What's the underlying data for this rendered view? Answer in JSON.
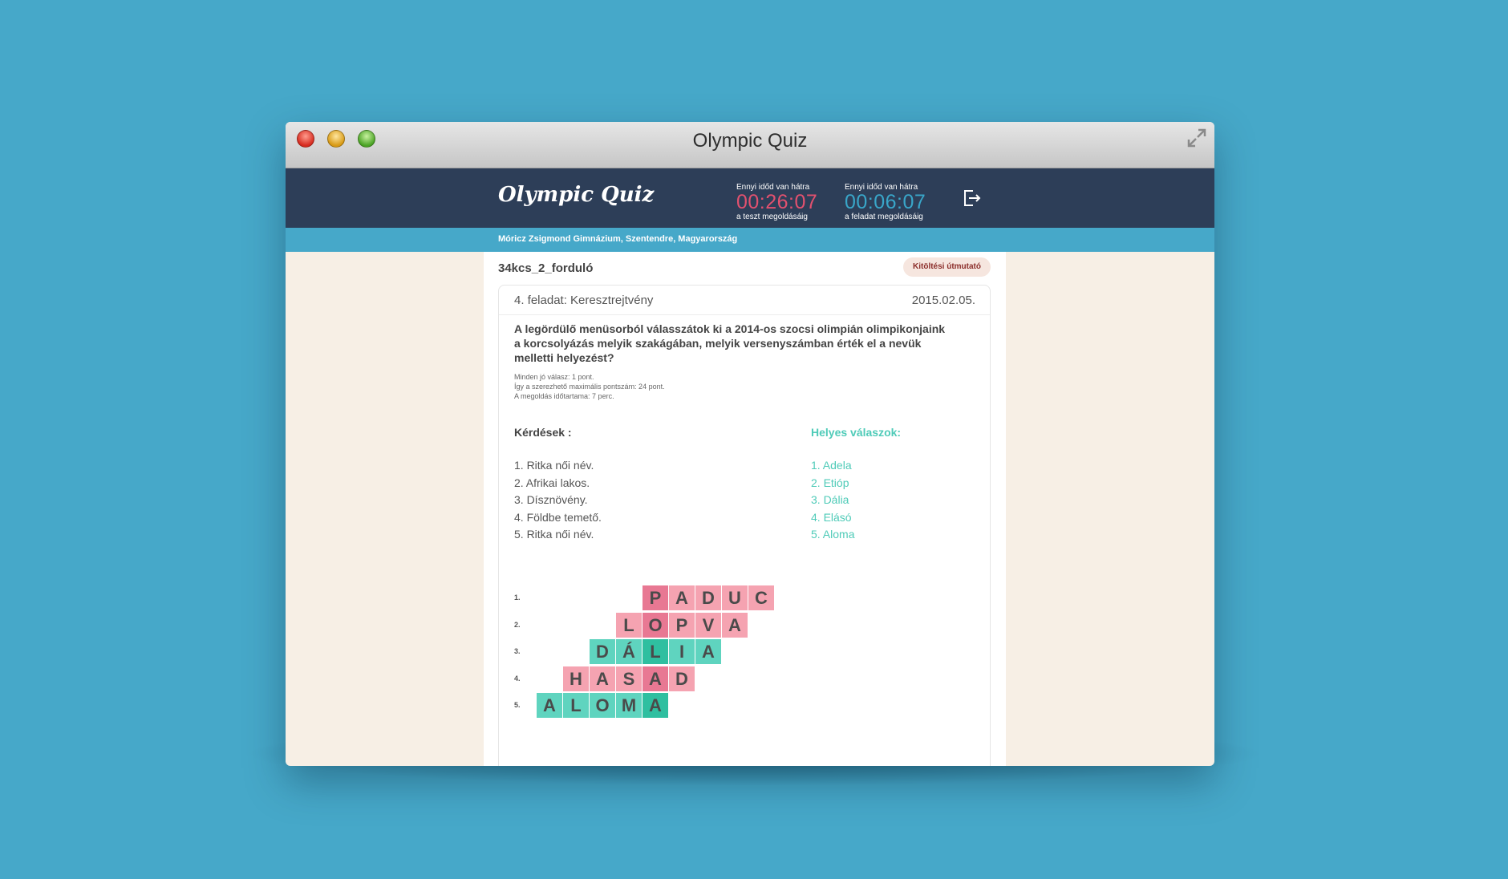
{
  "window": {
    "title": "Olympic Quiz"
  },
  "header": {
    "logo": "Olympic Quiz",
    "timer_test": {
      "label_top": "Ennyi időd van hátra",
      "value": "00:26:07",
      "label_bottom": "a teszt megoldásáig"
    },
    "timer_task": {
      "label_top": "Ennyi időd van hátra",
      "value": "00:06:07",
      "label_bottom": "a feladat megoldásáig"
    }
  },
  "school": "Móricz Zsigmond Gimnázium, Szentendre, Magyarország",
  "round": {
    "title": "34kcs_2_forduló",
    "guide_button": "Kitöltési útmutató"
  },
  "task": {
    "name": "4. feladat: Keresztrejtvény",
    "date": "2015.02.05.",
    "question": "A legördülő menüsorból válasszátok ki a 2014-os szocsi olimpián olimpikonjaink a korcsolyázás melyik szakágában, melyik versenyszámban érték el a nevük melletti helyezést?",
    "notes": [
      "Minden jó válasz: 1 pont.",
      "Így a szerezhető maximális pontszám: 24 pont.",
      "A megoldás időtartama: 7 perc."
    ],
    "questions_heading": "Kérdések :",
    "answers_heading": "Helyes válaszok:",
    "questions": [
      "1. Ritka női név.",
      "2. Afrikai lakos.",
      "3. Dísznövény.",
      "4. Földbe temető.",
      "5. Ritka női név."
    ],
    "answers": [
      "1. Adela",
      "2. Etióp",
      "3. Dália",
      "4. Elásó",
      "5. Aloma"
    ]
  },
  "crossword": {
    "rows": [
      {
        "label": "1.",
        "start": 4,
        "letters": [
          "P",
          "A",
          "D",
          "U",
          "C"
        ],
        "colors": [
          "pinkd",
          "pink",
          "pink",
          "pink",
          "pink"
        ]
      },
      {
        "label": "2.",
        "start": 3,
        "letters": [
          "L",
          "O",
          "P",
          "V",
          "A"
        ],
        "colors": [
          "pink",
          "pinkd",
          "pink",
          "pink",
          "pink"
        ]
      },
      {
        "label": "3.",
        "start": 2,
        "letters": [
          "D",
          "Á",
          "L",
          "I",
          "A"
        ],
        "colors": [
          "teal",
          "teal",
          "teald",
          "teal",
          "teal"
        ]
      },
      {
        "label": "4.",
        "start": 1,
        "letters": [
          "H",
          "A",
          "S",
          "A",
          "D"
        ],
        "colors": [
          "pink",
          "pink",
          "pink",
          "pinkd",
          "pink"
        ]
      },
      {
        "label": "5.",
        "start": 0,
        "letters": [
          "A",
          "L",
          "O",
          "M",
          "A"
        ],
        "colors": [
          "teal",
          "teal",
          "teal",
          "teal",
          "teald"
        ]
      }
    ]
  }
}
